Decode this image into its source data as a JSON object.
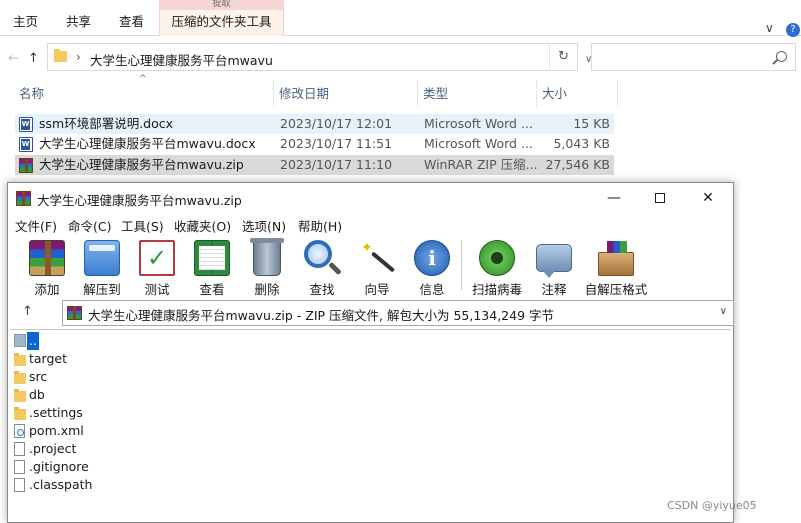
{
  "ribbon": {
    "tabs": [
      "主页",
      "共享",
      "查看"
    ],
    "context_group": "提取",
    "context_tab": "压缩的文件夹工具",
    "help_chevron": "∨",
    "help_icon": "?"
  },
  "address_bar": {
    "path": "大学生心理健康服务平台mwavu",
    "chevron": "›",
    "dropdown": "∨",
    "refresh": "↻"
  },
  "nav": {
    "back": "←",
    "forward": "→",
    "recent": "∨",
    "up": "↑"
  },
  "columns": [
    "名称",
    "修改日期",
    "类型",
    "大小"
  ],
  "sort_indicator": "^",
  "files": [
    {
      "name": "ssm环境部署说明.docx",
      "date": "2023/10/17 12:01",
      "type": "Microsoft Word ...",
      "size": "15 KB",
      "icon": "word-doc-icon"
    },
    {
      "name": "大学生心理健康服务平台mwavu.docx",
      "date": "2023/10/17 11:51",
      "type": "Microsoft Word ...",
      "size": "5,043 KB",
      "icon": "word-doc-icon"
    },
    {
      "name": "大学生心理健康服务平台mwavu.zip",
      "date": "2023/10/17 11:10",
      "type": "WinRAR ZIP 压缩...",
      "size": "27,546 KB",
      "icon": "winrar-archive-icon"
    }
  ],
  "winrar": {
    "title": "大学生心理健康服务平台mwavu.zip",
    "window_controls": {
      "minimize": "—",
      "close": "✕"
    },
    "menu": [
      "文件(F)",
      "命令(C)",
      "工具(S)",
      "收藏夹(O)",
      "选项(N)",
      "帮助(H)"
    ],
    "toolbar": [
      {
        "label": "添加",
        "icon": "add-archive-icon"
      },
      {
        "label": "解压到",
        "icon": "extract-to-icon"
      },
      {
        "label": "测试",
        "icon": "test-icon"
      },
      {
        "label": "查看",
        "icon": "view-icon"
      },
      {
        "label": "删除",
        "icon": "delete-icon"
      },
      {
        "label": "查找",
        "icon": "find-icon"
      },
      {
        "label": "向导",
        "icon": "wizard-icon"
      },
      {
        "label": "信息",
        "icon": "info-icon"
      },
      {
        "label": "扫描病毒",
        "icon": "virus-scan-icon"
      },
      {
        "label": "注释",
        "icon": "comment-icon"
      },
      {
        "label": "自解压格式",
        "icon": "sfx-icon"
      }
    ],
    "path_text": "大学生心理健康服务平台mwavu.zip - ZIP 压缩文件, 解包大小为 55,134,249 字节",
    "up_arrow": "↑",
    "path_dropdown": "∨",
    "entries": [
      {
        "name": "..",
        "kind": "parent"
      },
      {
        "name": "target",
        "kind": "folder"
      },
      {
        "name": "src",
        "kind": "folder"
      },
      {
        "name": "db",
        "kind": "folder"
      },
      {
        "name": ".settings",
        "kind": "folder"
      },
      {
        "name": "pom.xml",
        "kind": "xml"
      },
      {
        "name": ".project",
        "kind": "file"
      },
      {
        "name": ".gitignore",
        "kind": "file"
      },
      {
        "name": ".classpath",
        "kind": "file"
      }
    ]
  },
  "watermark": "CSDN @yiyue05",
  "colors": {
    "selection_blue": "#0a64d2",
    "row_hover": "#e5f1fb",
    "row_selected": "#d9d9d9",
    "context_tab_bg": "#fdf2e9"
  }
}
